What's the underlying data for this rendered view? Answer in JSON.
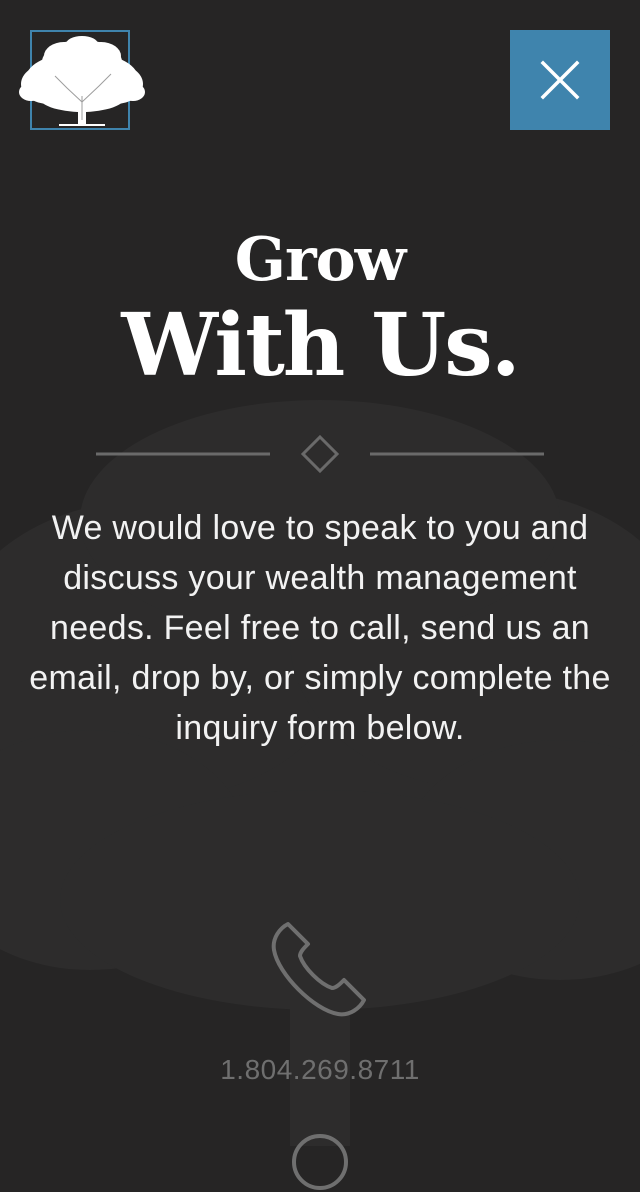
{
  "header": {
    "logo_icon": "oak-tree-logo-icon",
    "close_icon": "close-x-icon"
  },
  "hero": {
    "title_line1": "Grow",
    "title_line2": "With Us.",
    "divider_icon": "diamond-icon"
  },
  "intro": {
    "text": "We would love to speak to you and discuss your wealth management needs. Feel free to call, send us an email, drop by, or simply complete the inquiry form below."
  },
  "contact": {
    "phone_icon": "phone-icon",
    "phone_number": "1.804.269.8711"
  },
  "colors": {
    "background": "#262525",
    "accent": "#3f84ad",
    "text": "#ffffff",
    "muted": "#6f6f6f"
  }
}
